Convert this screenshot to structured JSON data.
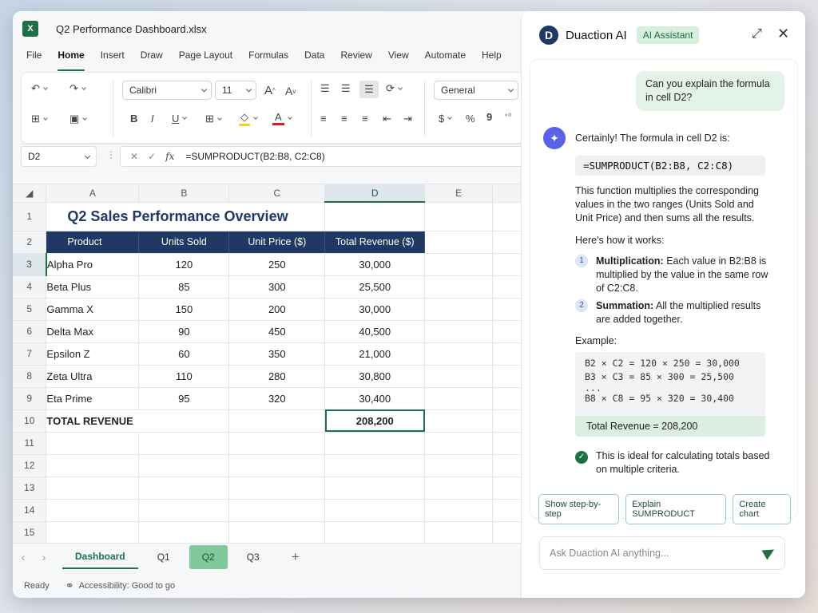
{
  "app": {
    "logo": "X",
    "file_title": "Q2 Performance Dashboard.xlsx"
  },
  "menu": [
    "File",
    "Home",
    "Insert",
    "Draw",
    "Page Layout",
    "Formulas",
    "Data",
    "Review",
    "View",
    "Automate",
    "Help"
  ],
  "ribbon": {
    "font_name": "Calibri",
    "font_size": "11",
    "number_format": "General",
    "bold": "B",
    "italic": "I",
    "underline": "U",
    "currency": "$",
    "percent": "%",
    "comma": "9"
  },
  "formula_bar": {
    "name_box": "D2",
    "fx": "fx",
    "formula": "=SUMPRODUCT(B2:B8, C2:C8)"
  },
  "sheet": {
    "columns": [
      "A",
      "B",
      "C",
      "D",
      "E"
    ],
    "title": "Q2 Sales Performance Overview",
    "headers": [
      "Product",
      "Units Sold",
      "Unit Price ($)",
      "Total Revenue ($)"
    ],
    "rows": [
      {
        "product": "Alpha Pro",
        "units": "120",
        "price": "250",
        "revenue": "30,000"
      },
      {
        "product": "Beta Plus",
        "units": "85",
        "price": "300",
        "revenue": "25,500"
      },
      {
        "product": "Gamma X",
        "units": "150",
        "price": "200",
        "revenue": "30,000"
      },
      {
        "product": "Delta Max",
        "units": "90",
        "price": "450",
        "revenue": "40,500"
      },
      {
        "product": "Epsilon Z",
        "units": "60",
        "price": "350",
        "revenue": "21,000"
      },
      {
        "product": "Zeta Ultra",
        "units": "110",
        "price": "280",
        "revenue": "30,800"
      },
      {
        "product": "Eta Prime",
        "units": "95",
        "price": "320",
        "revenue": "30,400"
      }
    ],
    "total_label": "TOTAL REVENUE",
    "total_value": "208,200",
    "row_numbers": [
      "1",
      "2",
      "3",
      "4",
      "5",
      "6",
      "7",
      "8",
      "9",
      "10",
      "11",
      "12",
      "13",
      "14",
      "15"
    ]
  },
  "tabs": [
    "Dashboard",
    "Q1",
    "Q2",
    "Q3"
  ],
  "status": {
    "ready": "Ready",
    "accessibility": "Accessibility: Good to go"
  },
  "assistant": {
    "logo": "D",
    "name": "Duaction AI",
    "badge": "AI Assistant",
    "user_message": "Can you explain the formula in cell D2?",
    "intro": "Certainly! The formula in cell D2 is:",
    "code": "=SUMPRODUCT(B2:B8, C2:C8)",
    "explain": "This function multiplies the corresponding values in the two ranges (Units Sold and Unit Price) and then sums all the results.",
    "how": "Here's how it works:",
    "step1_num": "1",
    "step1_title": "Multiplication:",
    "step1_text": "Each value in B2:B8 is multiplied by the value in the same row of C2:C8.",
    "step2_num": "2",
    "step2_title": "Summation:",
    "step2_text": "All the multiplied results are added together.",
    "example_label": "Example:",
    "example_lines": [
      "B2 × C2  =  120 × 250 = 30,000",
      "B3 × C3  =   85 × 300 = 25,500",
      "...",
      "B8 × C8  =   95 × 320 = 30,400"
    ],
    "example_total": "Total Revenue = 208,200",
    "note": "This is ideal for calculating totals based on multiple criteria.",
    "chips": [
      "Show step-by-step",
      "Explain SUMPRODUCT",
      "Create chart"
    ],
    "input_placeholder": "Ask Duaction AI anything..."
  },
  "colors": {
    "accent": "#1e7145",
    "header_blue": "#1f3864",
    "ai_purple": "#5a63e6"
  }
}
